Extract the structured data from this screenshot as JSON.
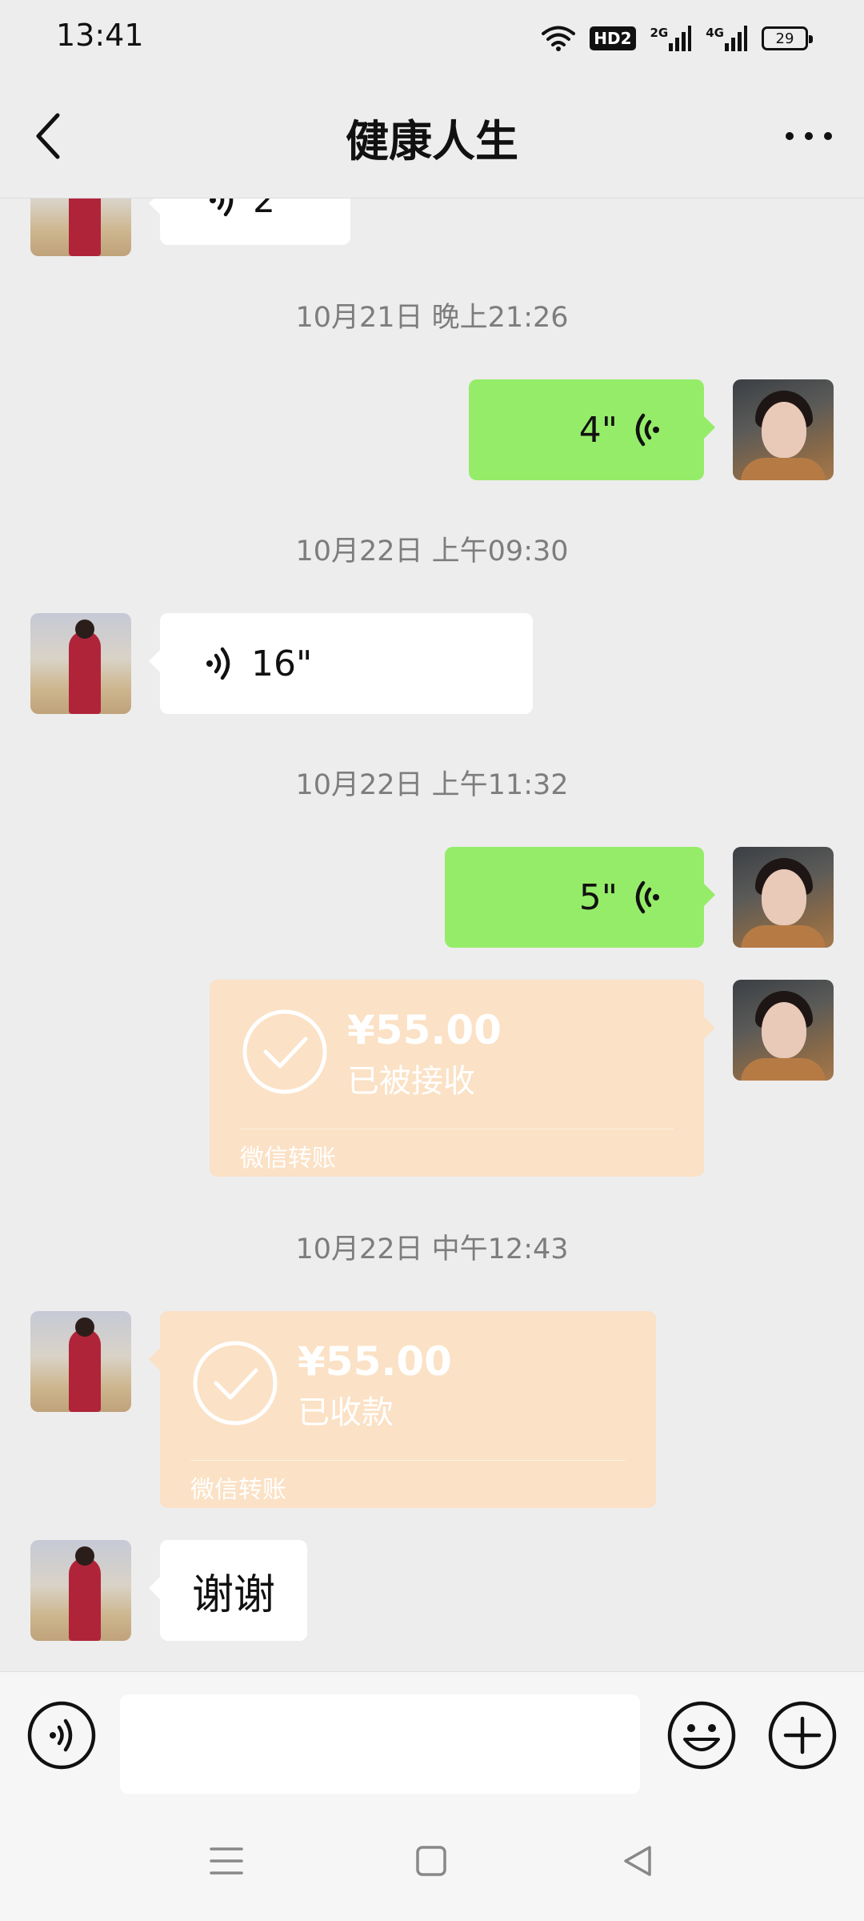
{
  "status_bar": {
    "time": "13:41",
    "hd_badge": "HD2",
    "net1": "2G",
    "net2": "4G",
    "battery": "29"
  },
  "header": {
    "title": "健康人生"
  },
  "messages": {
    "partial_voice_duration": "2\"",
    "ts1": "10月21日 晚上21:26",
    "voice_out_1": "4\"",
    "ts2": "10月22日 上午09:30",
    "voice_in_1": "16\"",
    "ts3": "10月22日 上午11:32",
    "voice_out_2": "5\"",
    "transfer_out": {
      "amount": "¥55.00",
      "status": "已被接收",
      "label": "微信转账"
    },
    "ts4": "10月22日 中午12:43",
    "transfer_in": {
      "amount": "¥55.00",
      "status": "已收款",
      "label": "微信转账"
    },
    "text_in_1": "谢谢"
  },
  "input_bar": {
    "value": ""
  },
  "colors": {
    "background": "#ededed",
    "outgoing_bubble": "#95ec69",
    "incoming_bubble": "#ffffff",
    "transfer_card": "#fbe1c5"
  }
}
